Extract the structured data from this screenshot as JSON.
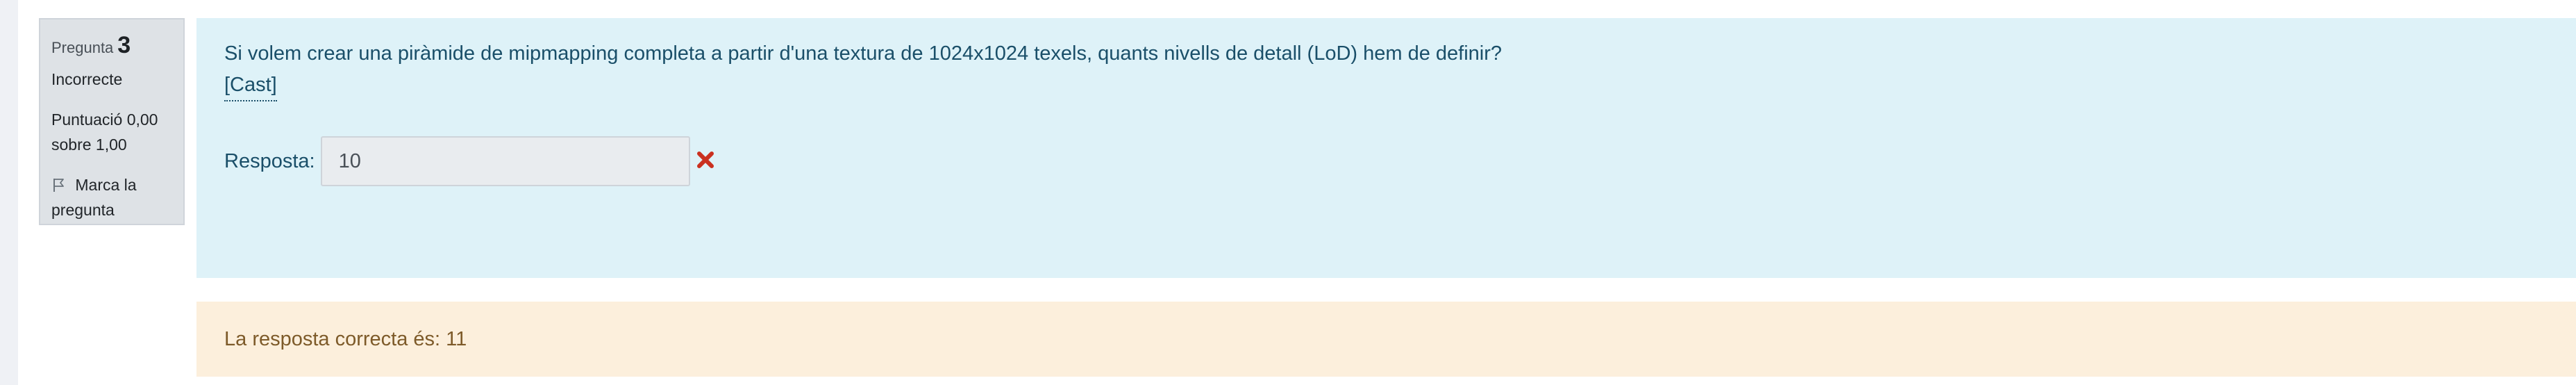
{
  "info": {
    "question_label": "Pregunta",
    "question_number": "3",
    "state": "Incorrecte",
    "grade_line1": "Puntuació 0,00",
    "grade_line2": "sobre 1,00",
    "flag_line1": "Marca la",
    "flag_line2": "pregunta",
    "flag_icon": "flag-icon"
  },
  "question": {
    "text": "Si volem crear una piràmide de mipmapping completa a partir d'una textura de 1024x1024 texels, quants nivells de detall (LoD) hem de definir?",
    "lang_link": "[Cast]",
    "answer_label": "Resposta:",
    "answer_value": "10",
    "result_icon": "cross-icon",
    "result_color": "#ca3120"
  },
  "feedback": {
    "right_answer": "La resposta correcta és: 11"
  },
  "colors": {
    "formulation_bg": "#def2f8",
    "feedback_bg": "#fcefdc",
    "info_bg": "#dee2e6"
  }
}
